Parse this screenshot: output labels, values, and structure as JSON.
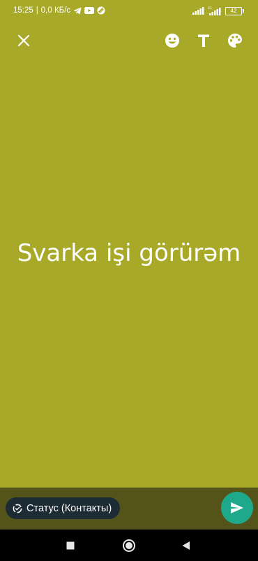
{
  "status_bar": {
    "time": "15:25",
    "separator": "|",
    "network_speed": "0,0 КБ/с",
    "battery": "42",
    "icons": [
      "telegram-icon",
      "youtube-icon",
      "vpn-icon",
      "signal-icon",
      "signal-icon",
      "wifi-icon"
    ]
  },
  "toolbar": {
    "close_icon": "close-icon",
    "emoji_icon": "emoji-icon",
    "text_icon": "text-icon",
    "palette_icon": "palette-icon"
  },
  "status_text": "Svarka işi görürəm",
  "bottom": {
    "audience_label": "Статус (Контакты)",
    "audience_icon": "status-ring-icon",
    "send_icon": "send-icon"
  },
  "nav": {
    "recents_icon": "square-icon",
    "home_icon": "circle-icon",
    "back_icon": "triangle-back-icon"
  },
  "colors": {
    "background": "#a8a829",
    "bottom_bar": "#54541a",
    "pill": "#1d2b35",
    "send": "#1fa98b"
  }
}
